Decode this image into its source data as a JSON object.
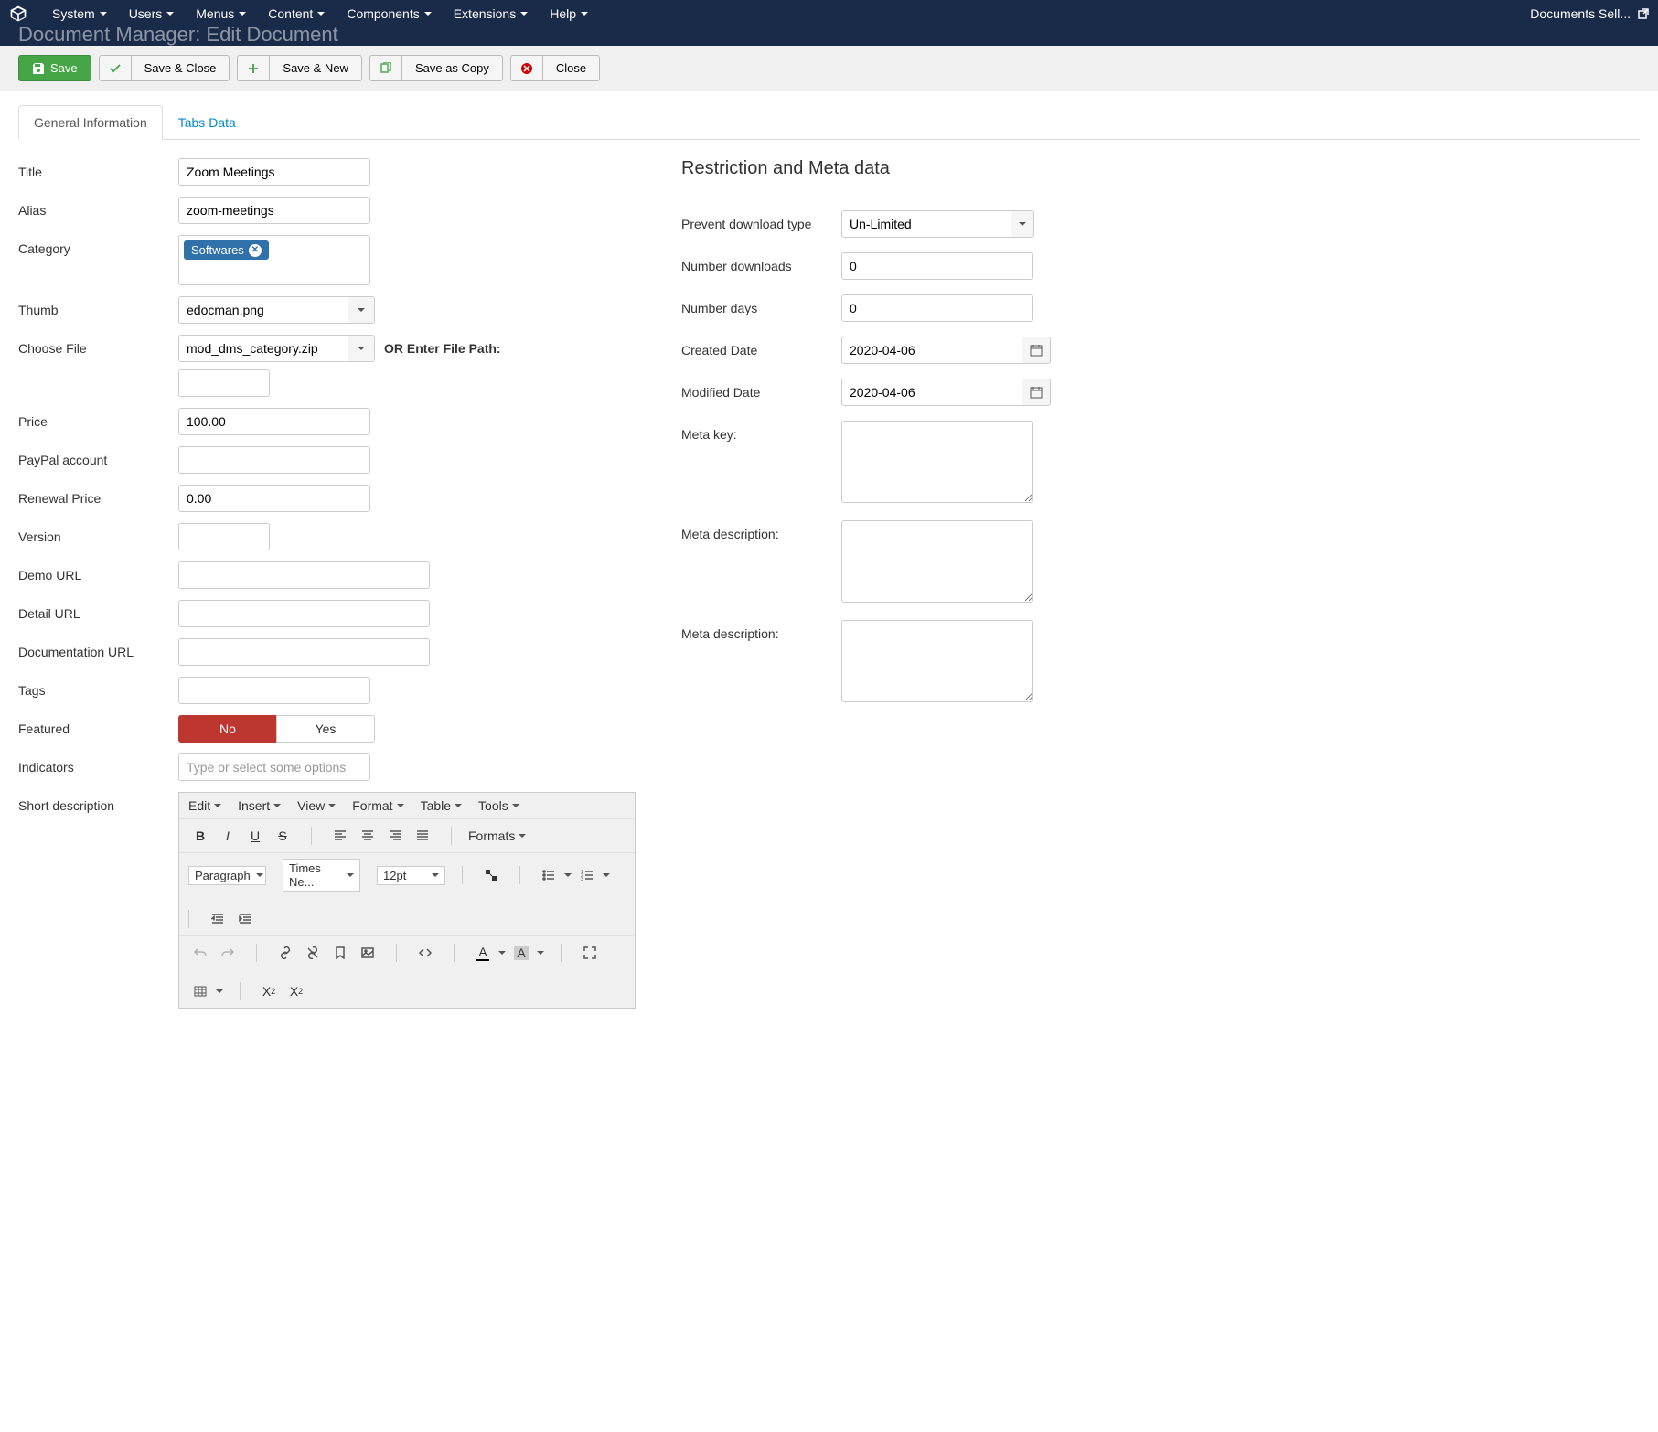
{
  "topnav": {
    "items": [
      "System",
      "Users",
      "Menus",
      "Content",
      "Components",
      "Extensions",
      "Help"
    ],
    "right": "Documents Sell..."
  },
  "subheader": {
    "title": "Document Manager: Edit Document"
  },
  "toolbar": {
    "save": "Save",
    "save_close": "Save & Close",
    "save_new": "Save & New",
    "save_copy": "Save as Copy",
    "close": "Close"
  },
  "tabs": {
    "general": "General Information",
    "tabs_data": "Tabs Data"
  },
  "form": {
    "title_label": "Title",
    "title_value": "Zoom Meetings",
    "alias_label": "Alias",
    "alias_value": "zoom-meetings",
    "category_label": "Category",
    "category_tag": "Softwares",
    "thumb_label": "Thumb",
    "thumb_value": "edocman.png",
    "choose_file_label": "Choose File",
    "choose_file_value": "mod_dms_category.zip",
    "or_enter_path": "OR Enter File Path:",
    "price_label": "Price",
    "price_value": "100.00",
    "paypal_label": "PayPal account",
    "renewal_label": "Renewal Price",
    "renewal_value": "0.00",
    "version_label": "Version",
    "demo_label": "Demo URL",
    "detail_label": "Detail URL",
    "doc_label": "Documentation URL",
    "tags_label": "Tags",
    "featured_label": "Featured",
    "featured_no": "No",
    "featured_yes": "Yes",
    "indicators_label": "Indicators",
    "indicators_placeholder": "Type or select some options",
    "short_desc_label": "Short description"
  },
  "editor": {
    "menus": [
      "Edit",
      "Insert",
      "View",
      "Format",
      "Table",
      "Tools"
    ],
    "formats": "Formats",
    "paragraph": "Paragraph",
    "font": "Times Ne...",
    "fontsize": "12pt"
  },
  "right": {
    "section_title": "Restriction and Meta data",
    "prevent_label": "Prevent download type",
    "prevent_value": "Un-Limited",
    "num_downloads_label": "Number downloads",
    "num_downloads_value": "0",
    "num_days_label": "Number days",
    "num_days_value": "0",
    "created_label": "Created Date",
    "created_value": "2020-04-06",
    "modified_label": "Modified Date",
    "modified_value": "2020-04-06",
    "meta_key_label": "Meta key:",
    "meta_desc_label": "Meta description:",
    "meta_desc2_label": "Meta description:"
  }
}
